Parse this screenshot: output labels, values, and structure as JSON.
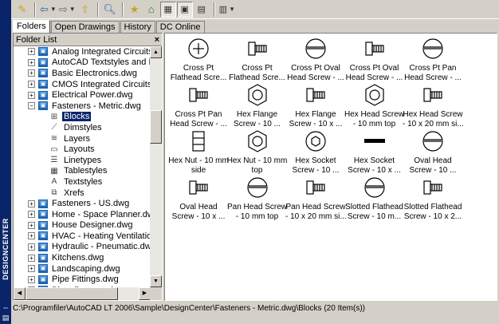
{
  "sidebar_title": "DESIGNCENTER",
  "tabs": [
    {
      "label": "Folders",
      "active": true
    },
    {
      "label": "Open Drawings",
      "active": false
    },
    {
      "label": "History",
      "active": false
    },
    {
      "label": "DC Online",
      "active": false
    }
  ],
  "folder_list": {
    "title": "Folder List",
    "close": "×"
  },
  "tree": [
    {
      "label": "Analog Integrated Circuits.dwg",
      "type": "dwg",
      "expander": "+"
    },
    {
      "label": "AutoCAD Textstyles and Linetypes.dwg",
      "type": "dwg",
      "expander": "+"
    },
    {
      "label": "Basic Electronics.dwg",
      "type": "dwg",
      "expander": "+"
    },
    {
      "label": "CMOS Integrated Circuits.dwg",
      "type": "dwg",
      "expander": "+"
    },
    {
      "label": "Electrical Power.dwg",
      "type": "dwg",
      "expander": "+"
    },
    {
      "label": "Fasteners - Metric.dwg",
      "type": "dwg",
      "expander": "−"
    },
    {
      "label": "Blocks",
      "type": "sub",
      "icon": "blocks-icon",
      "selected": true
    },
    {
      "label": "Dimstyles",
      "type": "sub",
      "icon": "dimstyles-icon"
    },
    {
      "label": "Layers",
      "type": "sub",
      "icon": "layers-icon"
    },
    {
      "label": "Layouts",
      "type": "sub",
      "icon": "layouts-icon"
    },
    {
      "label": "Linetypes",
      "type": "sub",
      "icon": "linetypes-icon"
    },
    {
      "label": "Tablestyles",
      "type": "sub",
      "icon": "tablestyles-icon"
    },
    {
      "label": "Textstyles",
      "type": "sub",
      "icon": "textstyles-icon"
    },
    {
      "label": "Xrefs",
      "type": "sub",
      "icon": "xrefs-icon"
    },
    {
      "label": "Fasteners - US.dwg",
      "type": "dwg",
      "expander": "+"
    },
    {
      "label": "Home - Space Planner.dwg",
      "type": "dwg",
      "expander": "+"
    },
    {
      "label": "House Designer.dwg",
      "type": "dwg",
      "expander": "+"
    },
    {
      "label": "HVAC - Heating Ventilation Air Conditioning.dwg",
      "type": "dwg",
      "expander": "+"
    },
    {
      "label": "Hydraulic - Pneumatic.dwg",
      "type": "dwg",
      "expander": "+"
    },
    {
      "label": "Kitchens.dwg",
      "type": "dwg",
      "expander": "+"
    },
    {
      "label": "Landscaping.dwg",
      "type": "dwg",
      "expander": "+"
    },
    {
      "label": "Pipe Fittings.dwg",
      "type": "dwg",
      "expander": "+"
    },
    {
      "label": "Plant Process.dwg",
      "type": "dwg",
      "expander": "+"
    }
  ],
  "items": [
    {
      "l1": "Cross Pt",
      "l2": "Flathead Scre...",
      "icon": "cross-pt-flathead-screw-icon"
    },
    {
      "l1": "Cross Pt",
      "l2": "Flathead Scre...",
      "icon": "cross-pt-flathead-screw-side-icon"
    },
    {
      "l1": "Cross Pt Oval",
      "l2": "Head Screw - ...",
      "icon": "cross-pt-oval-head-screw-icon"
    },
    {
      "l1": "Cross Pt Oval",
      "l2": "Head Screw - ...",
      "icon": "cross-pt-oval-head-screw-side-icon"
    },
    {
      "l1": "Cross Pt Pan",
      "l2": "Head Screw - ...",
      "icon": "cross-pt-pan-head-screw-icon"
    },
    {
      "l1": "Cross Pt Pan",
      "l2": "Head Screw - ...",
      "icon": "cross-pt-pan-head-screw-side-icon"
    },
    {
      "l1": "Hex Flange",
      "l2": "Screw - 10 ...",
      "icon": "hex-flange-screw-icon"
    },
    {
      "l1": "Hex Flange",
      "l2": "Screw - 10 x ...",
      "icon": "hex-flange-screw-side-icon"
    },
    {
      "l1": "Hex Head Screw",
      "l2": "- 10 mm top",
      "icon": "hex-head-screw-top-icon"
    },
    {
      "l1": "Hex Head Screw",
      "l2": "- 10 x 20 mm si...",
      "icon": "hex-head-screw-side-icon"
    },
    {
      "l1": "Hex Nut - 10 mm",
      "l2": "side",
      "icon": "hex-nut-side-icon"
    },
    {
      "l1": "Hex Nut - 10 mm",
      "l2": "top",
      "icon": "hex-nut-top-icon"
    },
    {
      "l1": "Hex Socket",
      "l2": "Screw - 10 ...",
      "icon": "hex-socket-screw-icon"
    },
    {
      "l1": "Hex Socket",
      "l2": "Screw - 10 x ...",
      "icon": "hex-socket-screw-side-icon"
    },
    {
      "l1": "Oval Head",
      "l2": "Screw - 10 ...",
      "icon": "oval-head-screw-icon"
    },
    {
      "l1": "Oval Head",
      "l2": "Screw - 10 x ...",
      "icon": "oval-head-screw-side-icon"
    },
    {
      "l1": "Pan Head Screw",
      "l2": "- 10 mm top",
      "icon": "pan-head-screw-top-icon"
    },
    {
      "l1": "Pan Head Screw",
      "l2": "- 10 x 20 mm si...",
      "icon": "pan-head-screw-side-icon"
    },
    {
      "l1": "Slotted Flathead",
      "l2": "Screw - 10 m...",
      "icon": "slotted-flathead-screw-icon"
    },
    {
      "l1": "Slotted Flathead",
      "l2": "Screw - 10 x 2...",
      "icon": "slotted-flathead-screw-side-icon"
    }
  ],
  "status_bar": "C:\\Programfiler\\AutoCAD LT 2006\\Sample\\DesignCenter\\Fasteners - Metric.dwg\\Blocks (20 Item(s))",
  "colors": {
    "title_bar": "#0a246a",
    "selection": "#0a246a",
    "chrome": "#d4d0c8"
  }
}
